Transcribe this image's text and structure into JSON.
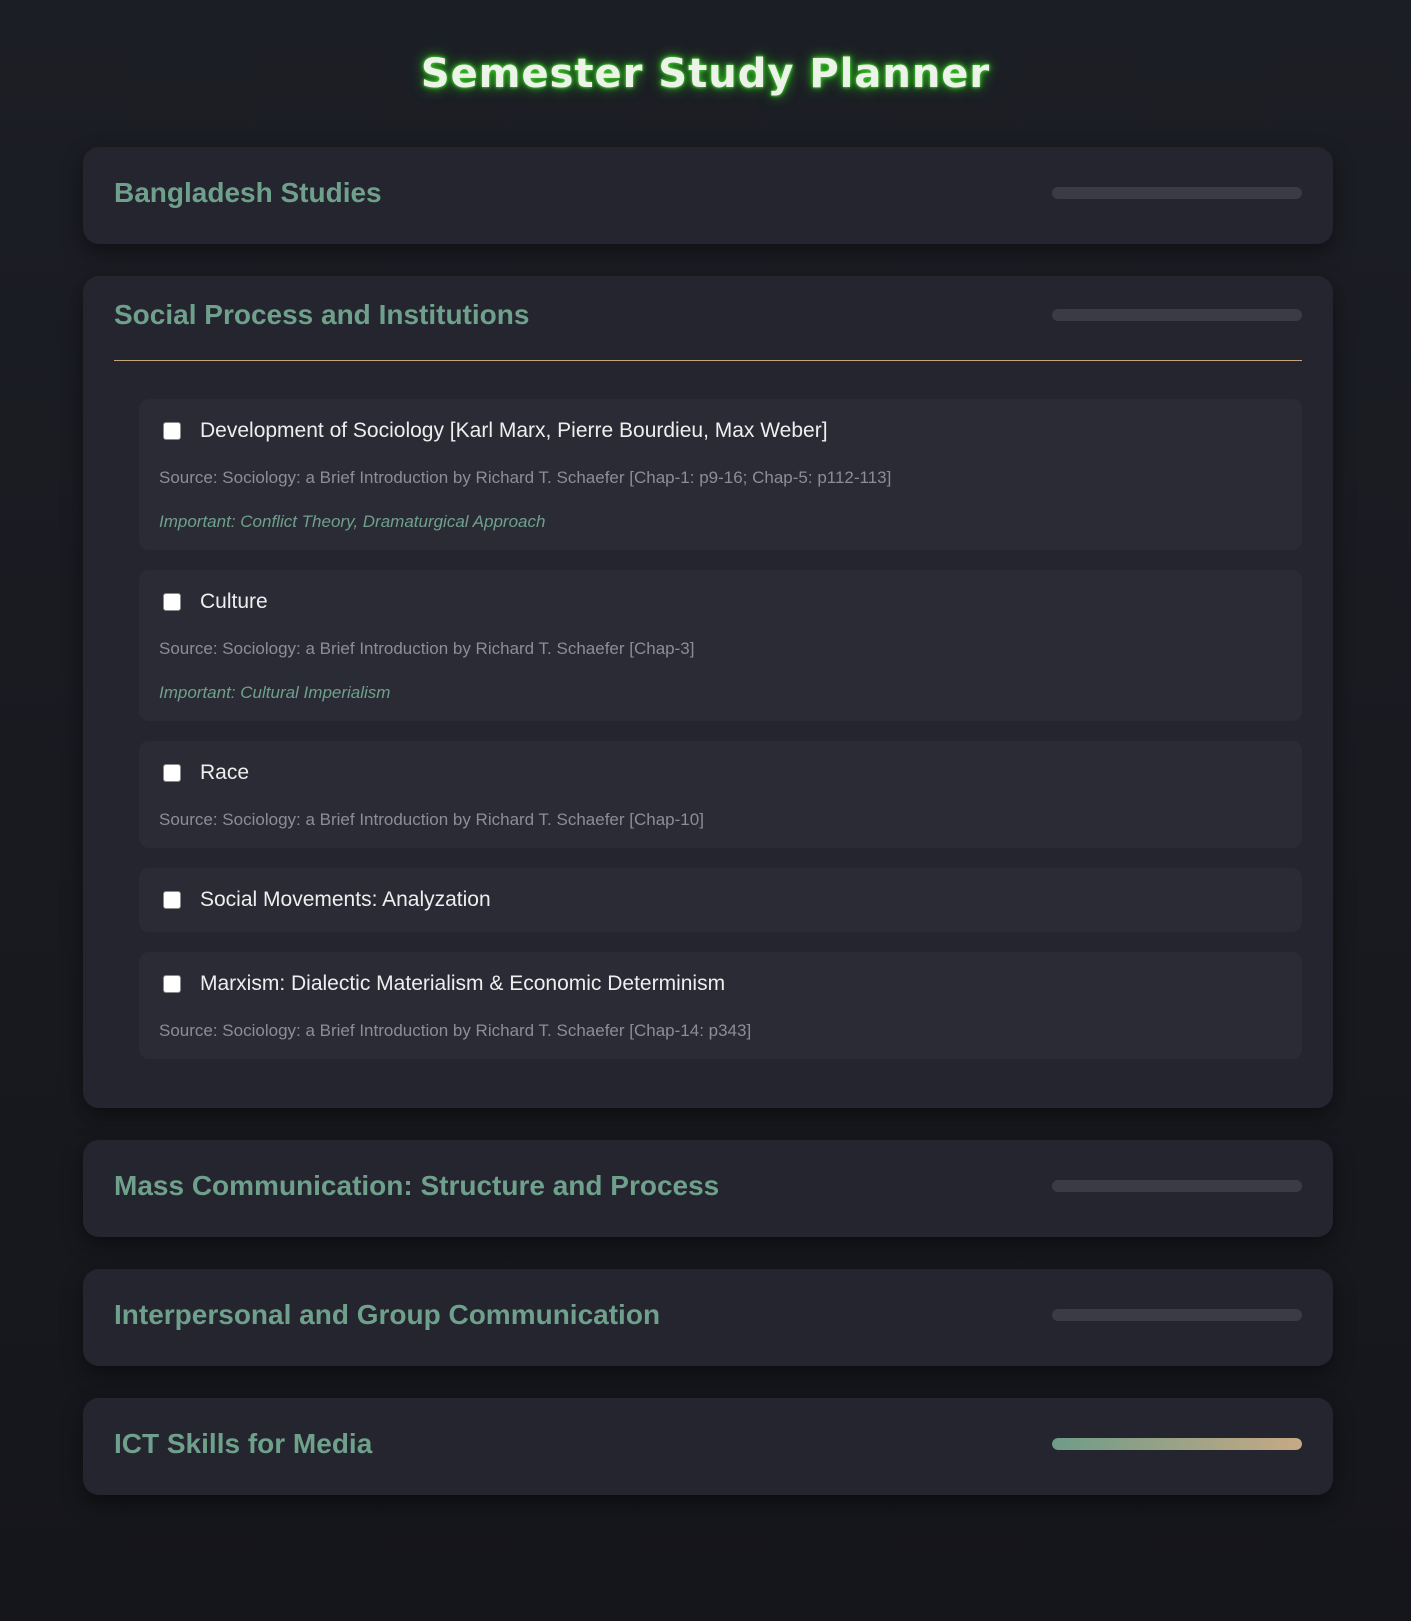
{
  "title": "Semester Study Planner",
  "colors": {
    "background": "#1a1b21",
    "card": "#24252e",
    "topic_card": "#2a2b35",
    "accent_green": "#6fa08c",
    "accent_gold": "#c4a57e",
    "title_glow": "#3ccf2a"
  },
  "subjects": [
    {
      "title": "Bangladesh Studies",
      "progress": 0,
      "expanded": false
    },
    {
      "title": "Social Process and Institutions",
      "progress": 0,
      "expanded": true,
      "topics": [
        {
          "name": "Development of Sociology [Karl Marx, Pierre Bourdieu, Max Weber]",
          "checked": false,
          "source": "Source: Sociology: a Brief Introduction by Richard T. Schaefer [Chap-1: p9-16; Chap-5: p112-113]",
          "important": "Important: Conflict Theory, Dramaturgical Approach"
        },
        {
          "name": "Culture",
          "checked": false,
          "source": "Source: Sociology: a Brief Introduction by Richard T. Schaefer [Chap-3]",
          "important": "Important: Cultural Imperialism"
        },
        {
          "name": "Race",
          "checked": false,
          "source": "Source: Sociology: a Brief Introduction by Richard T. Schaefer [Chap-10]"
        },
        {
          "name": "Social Movements: Analyzation",
          "checked": false
        },
        {
          "name": "Marxism: Dialectic Materialism & Economic Determinism",
          "checked": false,
          "source": "Source: Sociology: a Brief Introduction by Richard T. Schaefer [Chap-14: p343]"
        }
      ]
    },
    {
      "title": "Mass Communication: Structure and Process",
      "progress": 0,
      "expanded": false
    },
    {
      "title": "Interpersonal and Group Communication",
      "progress": 0,
      "expanded": false
    },
    {
      "title": "ICT Skills for Media",
      "progress": 100,
      "expanded": false
    }
  ]
}
